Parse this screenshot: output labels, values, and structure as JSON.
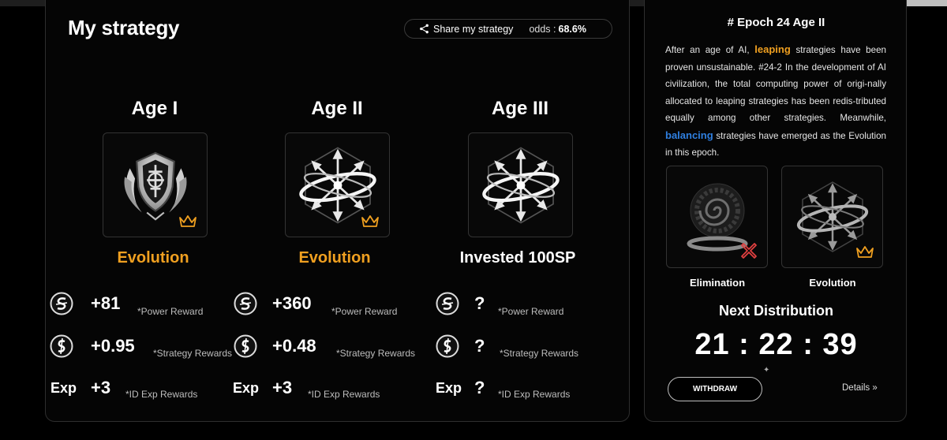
{
  "strategy": {
    "title": "My strategy",
    "share_label": "Share my strategy",
    "odds_label": "odds :",
    "odds_value": "68.6%",
    "ages": [
      {
        "name": "Age I",
        "emblem": "shield-wreath-emblem",
        "crown": true,
        "status": "Evolution",
        "status_color": "#f0a020",
        "power": "+81",
        "power_label": "*Power Reward",
        "strategy": "+0.95",
        "strategy_label": "*Strategy Rewards",
        "exp_prefix": "Exp",
        "exp": "+3",
        "exp_label": "*ID Exp Rewards"
      },
      {
        "name": "Age II",
        "emblem": "balancing-arrows-emblem",
        "crown": true,
        "status": "Evolution",
        "status_color": "#f0a020",
        "power": "+360",
        "power_label": "*Power Reward",
        "strategy": "+0.48",
        "strategy_label": "*Strategy Rewards",
        "exp_prefix": "Exp",
        "exp": "+3",
        "exp_label": "*ID Exp Rewards"
      },
      {
        "name": "Age III",
        "emblem": "balancing-arrows-emblem",
        "crown": false,
        "status": "Invested 100SP",
        "status_color": "#ffffff",
        "power": "?",
        "power_label": "*Power Reward",
        "strategy": "?",
        "strategy_label": "*Strategy Rewards",
        "exp_prefix": "Exp",
        "exp": "?",
        "exp_label": "*ID Exp Rewards"
      }
    ]
  },
  "epoch": {
    "title": "# Epoch 24 Age II",
    "text_1": "After an age of AI, ",
    "highlight_1": "leaping",
    "text_2": " strategies have been proven unsustainable. #24-2 In the development of AI civilization, the total computing power of origi-nally allocated to leaping strategies has been redis-tributed equally among other strategies. Meanwhile, ",
    "highlight_2": "balancing",
    "text_3": " strategies have emerged as the Evolution in this epoch.",
    "highlight_1_color": "#f0a020",
    "highlight_2_color": "#2f7fe0",
    "cards": [
      {
        "label": "Elimination",
        "emblem": "vortex-emblem",
        "marker": "red-x-icon"
      },
      {
        "label": "Evolution",
        "emblem": "balancing-arrows-emblem",
        "marker": "crown-icon"
      }
    ],
    "next_distribution_label": "Next Distribution",
    "countdown": "21 : 22 : 39",
    "withdraw_label": "WITHDRAW",
    "details_label": "Details »"
  },
  "colors": {
    "accent_orange": "#f0a020",
    "accent_blue": "#2f7fe0",
    "background": "#000000"
  }
}
